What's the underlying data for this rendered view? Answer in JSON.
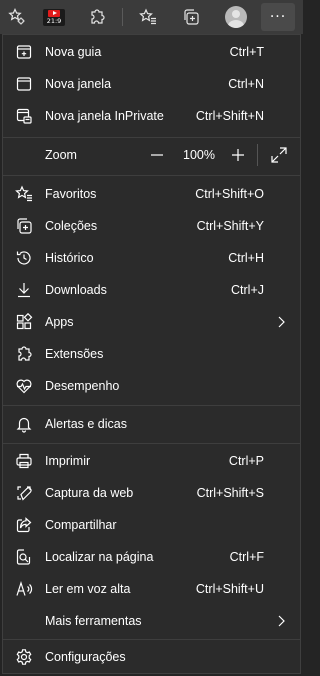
{
  "toolbar": {
    "buttons": [
      {
        "icon": "settings-star-icon"
      },
      {
        "icon": "youtube-extension-icon",
        "badge": "21:9"
      },
      {
        "icon": "extensions-icon"
      },
      {
        "icon": "favorites-icon"
      },
      {
        "icon": "collections-icon"
      },
      {
        "icon": "profile-avatar-icon"
      },
      {
        "icon": "more-icon",
        "label": "···"
      }
    ]
  },
  "menu": {
    "items": [
      {
        "id": "new-tab",
        "icon": "new-tab-icon",
        "label": "Nova guia",
        "shortcut": "Ctrl+T"
      },
      {
        "id": "new-window",
        "icon": "new-window-icon",
        "label": "Nova janela",
        "shortcut": "Ctrl+N"
      },
      {
        "id": "new-inprivate",
        "icon": "inprivate-icon",
        "label": "Nova janela InPrivate",
        "shortcut": "Ctrl+Shift+N"
      },
      {
        "id": "zoom",
        "label": "Zoom",
        "value": "100%",
        "minus": "—",
        "plus": "+"
      },
      {
        "id": "favorites",
        "icon": "favorites-icon",
        "label": "Favoritos",
        "shortcut": "Ctrl+Shift+O"
      },
      {
        "id": "collections",
        "icon": "collections-icon",
        "label": "Coleções",
        "shortcut": "Ctrl+Shift+Y"
      },
      {
        "id": "history",
        "icon": "history-icon",
        "label": "Histórico",
        "shortcut": "Ctrl+H"
      },
      {
        "id": "downloads",
        "icon": "download-icon",
        "label": "Downloads",
        "shortcut": "Ctrl+J"
      },
      {
        "id": "apps",
        "icon": "apps-icon",
        "label": "Apps",
        "submenu": true
      },
      {
        "id": "extensions",
        "icon": "extensions-icon",
        "label": "Extensões"
      },
      {
        "id": "performance",
        "icon": "performance-icon",
        "label": "Desempenho"
      },
      {
        "id": "alerts",
        "icon": "bell-icon",
        "label": "Alertas e dicas"
      },
      {
        "id": "print",
        "icon": "printer-icon",
        "label": "Imprimir",
        "shortcut": "Ctrl+P"
      },
      {
        "id": "web-capture",
        "icon": "web-capture-icon",
        "label": "Captura da web",
        "shortcut": "Ctrl+Shift+S"
      },
      {
        "id": "share",
        "icon": "share-icon",
        "label": "Compartilhar"
      },
      {
        "id": "find",
        "icon": "find-icon",
        "label": "Localizar na página",
        "shortcut": "Ctrl+F"
      },
      {
        "id": "read-aloud",
        "icon": "read-aloud-icon",
        "label": "Ler em voz alta",
        "shortcut": "Ctrl+Shift+U"
      },
      {
        "id": "more-tools",
        "label": "Mais ferramentas",
        "submenu": true
      },
      {
        "id": "settings",
        "icon": "gear-icon",
        "label": "Configurações"
      }
    ]
  },
  "colors": {
    "toolbar": "#3b3b3b",
    "menu_bg": "#2b2b2b",
    "text": "#ffffff",
    "separator": "#3e3e3e",
    "youtube_red": "#e21b1b"
  }
}
